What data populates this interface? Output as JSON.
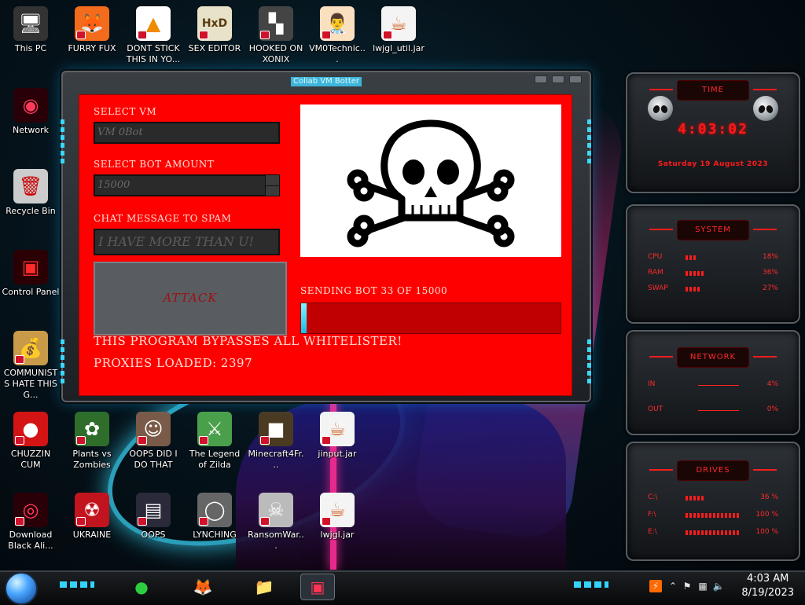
{
  "window": {
    "title": "Collab VM Botter",
    "labels": {
      "select_vm": "SELECT VM",
      "select_bot_amount": "SELECT BOT AMOUNT",
      "chat_message": "CHAT MESSAGE TO SPAM"
    },
    "vm_value": "VM 0Bot",
    "bot_amount_value": "15000",
    "spam_value": "I HAVE MORE THAN U!",
    "attack_label": "ATTACK",
    "progress_label": "SENDING BOT 33 OF 15000",
    "progress_fraction": 0.022,
    "message_1": "THIS PROGRAM BYPASSES ALL WHITELISTER!",
    "message_2": "PROXIES LOADED: 2397"
  },
  "desktop_icons": [
    {
      "label": "This PC",
      "icon": "computer-icon"
    },
    {
      "label": "FURRY FUX",
      "icon": "firefox-icon"
    },
    {
      "label": "DONT STICK THIS IN YO...",
      "icon": "vlc-cone-icon"
    },
    {
      "label": "SEX EDITOR",
      "icon": "hxd-icon"
    },
    {
      "label": "HOOKED ON XONIX",
      "icon": "xonix-game-icon"
    },
    {
      "label": "VM0Technic...",
      "icon": "doctor-icon"
    },
    {
      "label": "lwjgl_util.jar",
      "icon": "java-icon"
    },
    {
      "label": "Network",
      "icon": "network-icon"
    },
    {
      "label": "Recycle Bin",
      "icon": "recycle-bin-icon"
    },
    {
      "label": "Control Panel",
      "icon": "control-panel-icon"
    },
    {
      "label": "COMMUNISTS HATE THIS G...",
      "icon": "money-bag-icon"
    },
    {
      "label": "CHUZZIN CUM",
      "icon": "chuzzle-icon"
    },
    {
      "label": "Plants vs Zombies",
      "icon": "plant-icon"
    },
    {
      "label": "OOPS DID I DO THAT",
      "icon": "portrait-icon"
    },
    {
      "label": "The Legend of Zilda",
      "icon": "zelda-icon"
    },
    {
      "label": "Minecraft4Fr...",
      "icon": "minecraft-icon"
    },
    {
      "label": "jinput.jar",
      "icon": "java-icon"
    },
    {
      "label": "Download Black Ali...",
      "icon": "alien-orb-icon"
    },
    {
      "label": "UKRAINE",
      "icon": "radiation-icon"
    },
    {
      "label": "OOPS",
      "icon": "oops-icon"
    },
    {
      "label": "LYNCHING",
      "icon": "noose-icon"
    },
    {
      "label": "RansomWar...",
      "icon": "skull-icon"
    },
    {
      "label": "lwjgl.jar",
      "icon": "java-icon"
    }
  ],
  "gadgets": {
    "time": {
      "title": "TIME",
      "clock": "4:03:02",
      "date": "Saturday 19 August 2023"
    },
    "system": {
      "title": "SYSTEM",
      "rows": [
        {
          "label": "CPU",
          "value": "18%",
          "level": 0.18
        },
        {
          "label": "RAM",
          "value": "36%",
          "level": 0.36
        },
        {
          "label": "SWAP",
          "value": "27%",
          "level": 0.27
        }
      ]
    },
    "network": {
      "title": "NETWORK",
      "rows": [
        {
          "label": "IN",
          "value": "4%"
        },
        {
          "label": "OUT",
          "value": "0%"
        }
      ]
    },
    "drives": {
      "title": "DRIVES",
      "rows": [
        {
          "label": "C:\\",
          "value": "36 %",
          "level": 0.36
        },
        {
          "label": "F:\\",
          "value": "100 %",
          "level": 1.0
        },
        {
          "label": "E:\\",
          "value": "100 %",
          "level": 1.0
        }
      ]
    }
  },
  "taskbar": {
    "apps": [
      {
        "icon": "chat-app-icon"
      },
      {
        "icon": "firefox-icon"
      },
      {
        "icon": "file-explorer-icon"
      },
      {
        "icon": "collab-vm-botter-icon",
        "active": true
      }
    ],
    "clock_time": "4:03 AM",
    "clock_date": "8/19/2023"
  },
  "colors": {
    "panel_red": "#ff0000",
    "accent_cyan": "#34d4ff",
    "gadget_red": "#ff1a1a"
  }
}
